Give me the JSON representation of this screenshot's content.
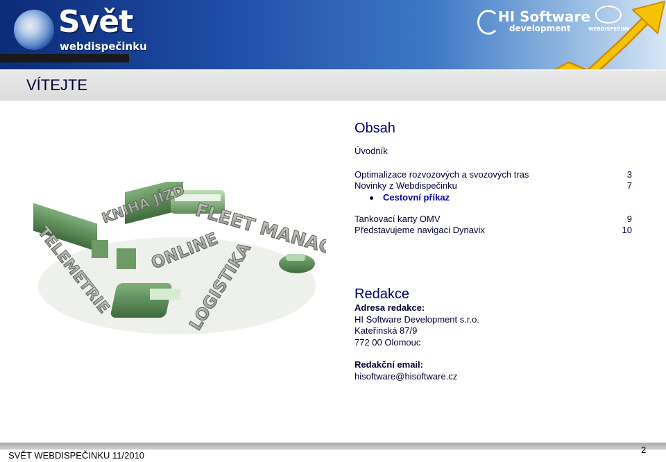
{
  "banner": {
    "logo_title": "Svět",
    "logo_subtitle": "webdispečinku",
    "partner_name": "HI Software",
    "partner_tagline": "development",
    "partner2_name": "WEBDISPEČINK"
  },
  "page": {
    "title": "VÍTEJTE"
  },
  "illustration": {
    "words": [
      "KNIHA JÍZD",
      "FLEET MANAGEMENT",
      "TELEMETRIE",
      "ONLINE",
      "LOGISTIKA"
    ]
  },
  "toc": {
    "heading": "Obsah",
    "intro": "Úvodník",
    "entries": [
      {
        "label": "Optimalizace rozvozových a svozových tras",
        "page": "3"
      },
      {
        "label": "Novinky z Webdispečinku",
        "page": "7"
      }
    ],
    "sub_entry": "Cestovní příkaz",
    "entries2": [
      {
        "label": "Tankovací karty OMV",
        "page": "9"
      },
      {
        "label": "Představujeme navigaci Dynavix",
        "page": "10"
      }
    ]
  },
  "editorial": {
    "heading": "Redakce",
    "address_label": "Adresa redakce:",
    "company": "HI Software Development s.r.o.",
    "street": "Kateřinská 87/9",
    "city": "772 00 Olomouc",
    "email_label": "Redakční email:",
    "email": "hisoftware@hisoftware.cz"
  },
  "footer": {
    "text": "SVĚT WEBDISPEČINKU 11/2010",
    "page_number": "2"
  },
  "colors": {
    "banner_dark": "#0c2b78",
    "heading": "#000066",
    "sub_entry": "#000099",
    "arrow": "#f5b800"
  }
}
